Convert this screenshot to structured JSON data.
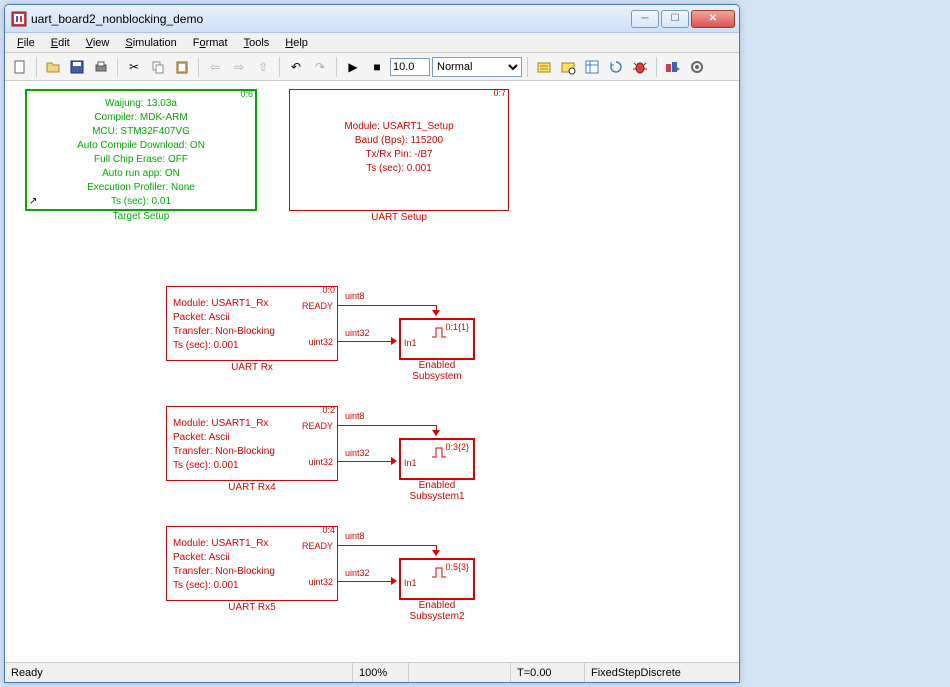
{
  "window": {
    "title": "uart_board2_nonblocking_demo"
  },
  "menu": {
    "file": "File",
    "edit": "Edit",
    "view": "View",
    "simulation": "Simulation",
    "format": "Format",
    "tools": "Tools",
    "help": "Help"
  },
  "toolbar": {
    "stoptime": "10.0",
    "mode": "Normal"
  },
  "status": {
    "ready": "Ready",
    "zoom": "100%",
    "time": "T=0.00",
    "solver": "FixedStepDiscrete"
  },
  "blocks": {
    "target": {
      "tag": "0:6",
      "l1": "Waijung: 13.03a",
      "l2": "Compiler: MDK-ARM",
      "l3": "MCU: STM32F407VG",
      "l4": "Auto Compile Download: ON",
      "l5": "Full Chip Erase: OFF",
      "l6": "Auto run app: ON",
      "l7": "Execution Profiler: None",
      "l8": "Ts (sec): 0.01",
      "label": "Target Setup"
    },
    "uartsetup": {
      "tag": "0:7",
      "l1": "Module: USART1_Setup",
      "l2": "Baud (Bps): 115200",
      "l3": "Tx/Rx Pin: -/B7",
      "l4": "Ts (sec): 0.001",
      "label": "UART Setup"
    },
    "rx": [
      {
        "tag": "0:0",
        "l1": "Module: USART1_Rx",
        "l2": "Packet: Ascii",
        "l3": "Transfer: Non-Blocking",
        "l4": "Ts (sec): 0.001",
        "p1": "READY",
        "p2": "uint32",
        "label": "UART Rx",
        "sig1": "uint8",
        "sig2": "uint32",
        "en": {
          "tag": "0:1{1}",
          "in": "In1",
          "label": "Enabled\nSubsystem"
        }
      },
      {
        "tag": "0:2",
        "l1": "Module: USART1_Rx",
        "l2": "Packet: Ascii",
        "l3": "Transfer: Non-Blocking",
        "l4": "Ts (sec): 0.001",
        "p1": "READY",
        "p2": "uint32",
        "label": "UART Rx4",
        "sig1": "uint8",
        "sig2": "uint32",
        "en": {
          "tag": "0:3{2}",
          "in": "In1",
          "label": "Enabled\nSubsystem1"
        }
      },
      {
        "tag": "0:4",
        "l1": "Module: USART1_Rx",
        "l2": "Packet: Ascii",
        "l3": "Transfer: Non-Blocking",
        "l4": "Ts (sec): 0.001",
        "p1": "READY",
        "p2": "uint32",
        "label": "UART Rx5",
        "sig1": "uint8",
        "sig2": "uint32",
        "en": {
          "tag": "0:5{3}",
          "in": "In1",
          "label": "Enabled\nSubsystem2"
        }
      }
    ]
  }
}
